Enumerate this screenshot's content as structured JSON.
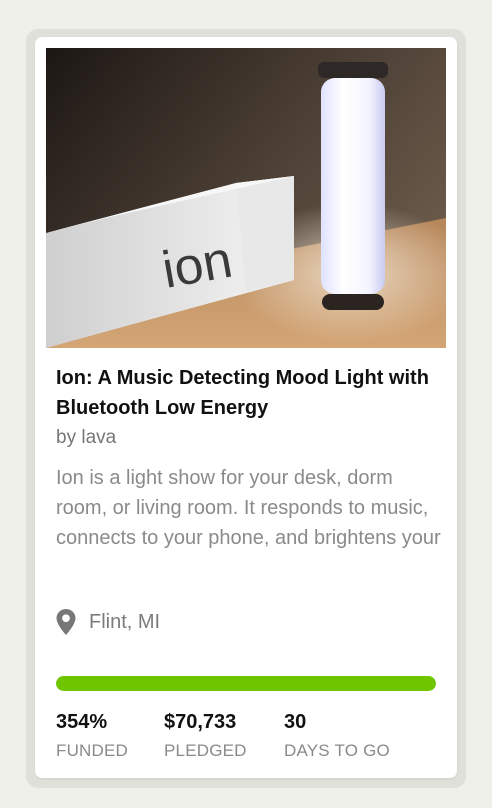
{
  "project": {
    "image_alt": "Ion lamp next to its box",
    "box_text": "ion",
    "title": "Ion: A Music Detecting Mood Light with Bluetooth Low Energy",
    "byline": "by lava",
    "blurb": "Ion is a light show for your desk, dorm room, or living room. It responds to music, connects to your phone, and brightens your",
    "location": "Flint, MI",
    "location_icon": "map-pin-icon"
  },
  "progress": {
    "percent_funded": 354,
    "fill_fraction": 1.0,
    "color": "#6fc500"
  },
  "stats": [
    {
      "value": "354%",
      "label": "FUNDED"
    },
    {
      "value": "$70,733",
      "label": "PLEDGED"
    },
    {
      "value": "30",
      "label": "DAYS TO GO"
    }
  ]
}
